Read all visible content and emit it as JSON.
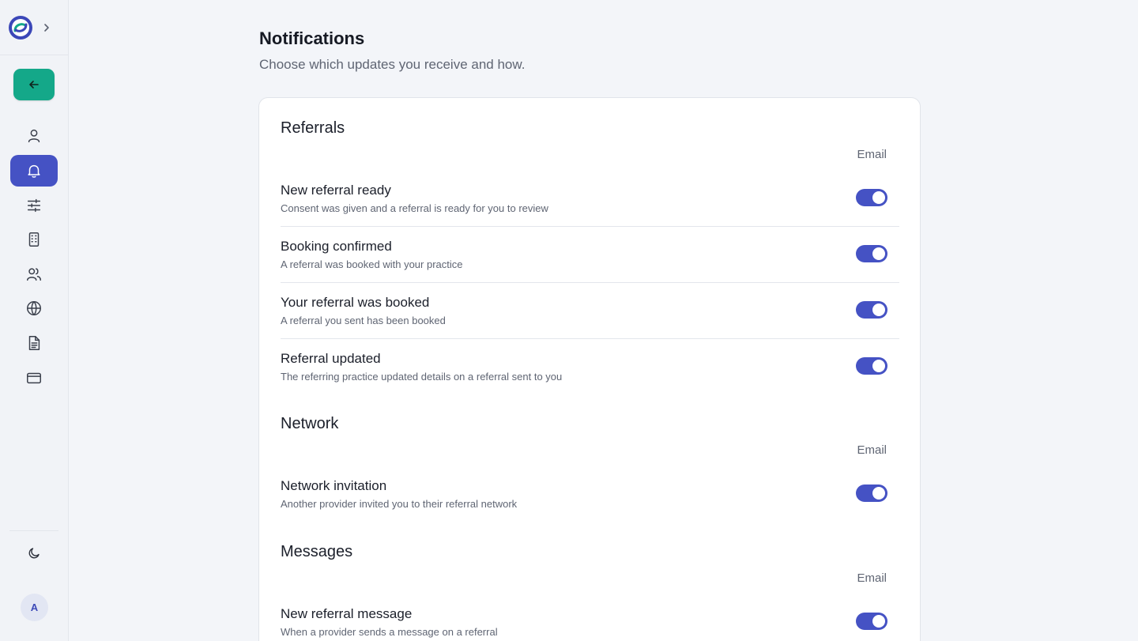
{
  "page": {
    "title": "Notifications",
    "subtitle": "Choose which updates you receive and how."
  },
  "sidebar": {
    "nav": [
      {
        "icon": "user-icon",
        "active": false
      },
      {
        "icon": "bell-icon",
        "active": true
      },
      {
        "icon": "sliders-icon",
        "active": false
      },
      {
        "icon": "building-icon",
        "active": false
      },
      {
        "icon": "users-icon",
        "active": false
      },
      {
        "icon": "globe-icon",
        "active": false
      },
      {
        "icon": "document-icon",
        "active": false
      },
      {
        "icon": "credit-card-icon",
        "active": false
      }
    ],
    "avatar_initial": "A"
  },
  "sections": [
    {
      "title": "Referrals",
      "column": "Email",
      "items": [
        {
          "title": "New referral ready",
          "desc": "Consent was given and a referral is ready for you to review",
          "email": true
        },
        {
          "title": "Booking confirmed",
          "desc": "A referral was booked with your practice",
          "email": true
        },
        {
          "title": "Your referral was booked",
          "desc": "A referral you sent has been booked",
          "email": true
        },
        {
          "title": "Referral updated",
          "desc": "The referring practice updated details on a referral sent to you",
          "email": true
        }
      ]
    },
    {
      "title": "Network",
      "column": "Email",
      "items": [
        {
          "title": "Network invitation",
          "desc": "Another provider invited you to their referral network",
          "email": true
        }
      ]
    },
    {
      "title": "Messages",
      "column": "Email",
      "items": [
        {
          "title": "New referral message",
          "desc": "When a provider sends a message on a referral",
          "email": true
        }
      ]
    }
  ],
  "colors": {
    "accent": "#4552c4",
    "back_button": "#14a889"
  }
}
